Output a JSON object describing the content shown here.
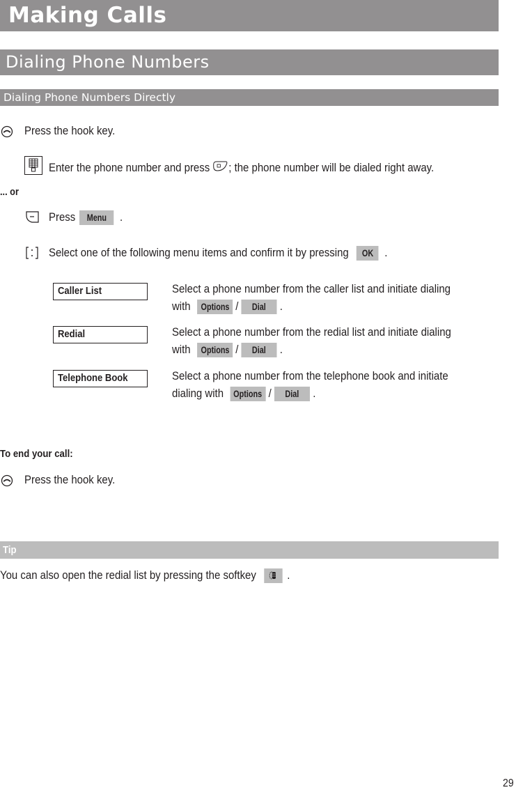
{
  "headings": {
    "chapter": "Making Calls",
    "section": "Dialing Phone Numbers",
    "subsection": "Dialing Phone Numbers Directly"
  },
  "steps": {
    "hook_press": "Press the hook key.",
    "enter_number_pre": "Enter the phone number and press",
    "enter_number_post": "; the phone number will be dialed right away.",
    "or_label": "... or",
    "press_label": "Press",
    "menu_key": "Menu",
    "period": ".",
    "select_pre": "Select one of the following menu items and confirm it by pressing",
    "ok_key": "OK"
  },
  "menu_items": [
    {
      "label": "Caller List",
      "desc_line1": "Select a phone number from the caller list and initiate dialing",
      "desc_line2_pre": "with",
      "key1": "Options",
      "separator": "/",
      "key2": "Dial",
      "end": "."
    },
    {
      "label": "Redial",
      "desc_line1": "Select a phone number from the redial list and initiate dialing",
      "desc_line2_pre": "with",
      "key1": "Options",
      "separator": "/",
      "key2": "Dial",
      "end": "."
    },
    {
      "label": "Telephone Book",
      "desc_line1": "Select a phone number from the telephone book and initiate",
      "desc_line2_pre": "dialing with",
      "key1": "Options",
      "separator": "/",
      "key2": "Dial",
      "end": "."
    }
  ],
  "end_call": {
    "heading": "To end your call:",
    "step": "Press the hook key."
  },
  "tip": {
    "heading": "Tip",
    "text": "You can also open the redial list by pressing the softkey",
    "end": "."
  },
  "icons": {
    "hook": "hook-key-icon",
    "keypad": "keypad-icon",
    "call_key": "call-key-icon",
    "left_softkey": "left-softkey-icon",
    "nav_key": "navigation-key-icon",
    "redial_softkey": "redial-softkey-icon"
  },
  "page_number": "29",
  "colors": {
    "heading_bar": "#929091",
    "tip_bar": "#bcbcbc",
    "key_bg": "#bcbcbc",
    "text": "#231f20"
  }
}
